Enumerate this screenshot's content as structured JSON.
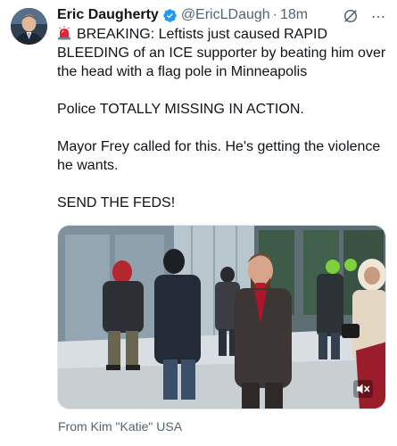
{
  "author": {
    "name": "Eric Daugherty",
    "handle": "@EricLDaugh",
    "separator": "·",
    "time": "18m"
  },
  "tweet": {
    "lines": [
      "BREAKING: Leftists just caused RAPID BLEEDING of an ICE supporter by beating him over the head with a flag pole in Minneapolis",
      "Police TOTALLY MISSING IN ACTION.",
      "Mayor Frey called for this. He's getting the violence he wants.",
      "SEND THE FEDS!"
    ]
  },
  "media": {
    "source": "From Kim \"Katie\" USA"
  },
  "icons": {
    "verified": "verified-badge-icon",
    "grok": "grok-icon",
    "more": "more-icon",
    "siren": "siren-emoji-icon",
    "mute": "volume-muted-icon"
  },
  "colors": {
    "verified": "#1d9bf0",
    "text": "#0f1419",
    "secondary": "#536471"
  }
}
